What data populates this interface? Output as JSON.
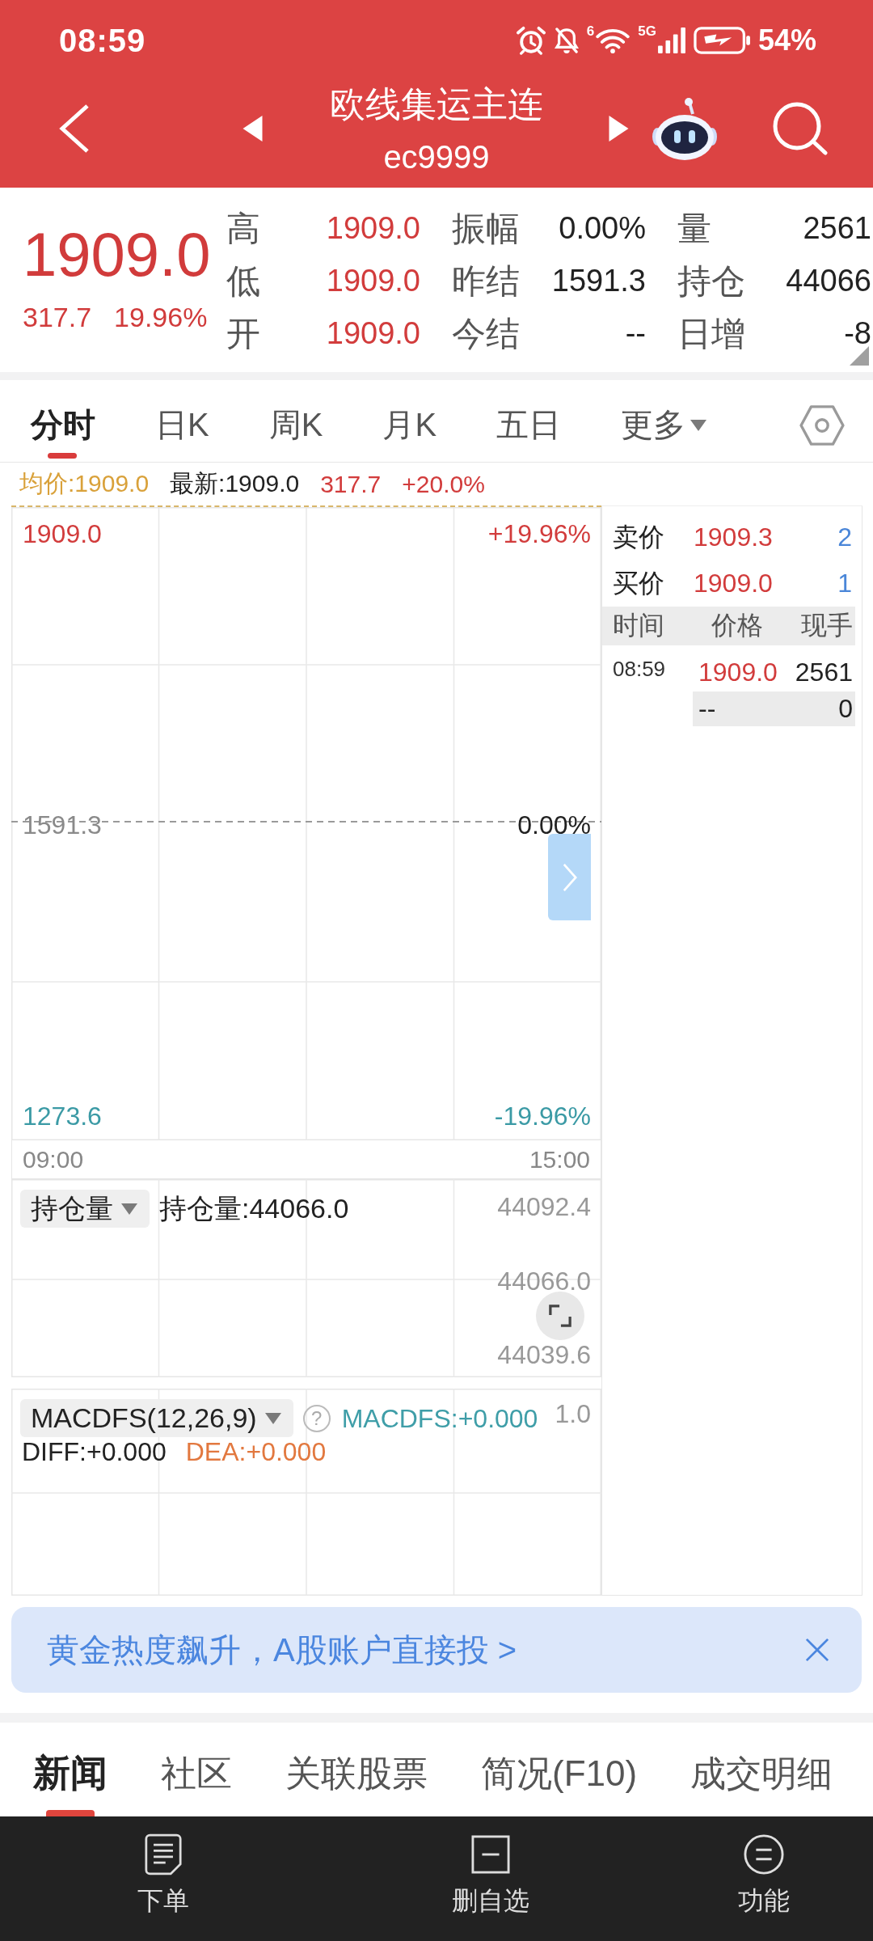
{
  "status_bar": {
    "time": "08:59",
    "wifi_label": "6",
    "signal_label": "5G",
    "battery": "54%"
  },
  "header": {
    "title": "欧线集运主连",
    "code": "ec9999"
  },
  "quote": {
    "price": "1909.0",
    "change": "317.7",
    "change_pct": "19.96%",
    "fields": [
      {
        "label": "高",
        "value": "1909.0",
        "kind": "up"
      },
      {
        "label": "振幅",
        "value": "0.00%",
        "kind": "flat"
      },
      {
        "label": "量",
        "value": "2561",
        "kind": "flat"
      },
      {
        "label": "低",
        "value": "1909.0",
        "kind": "up"
      },
      {
        "label": "昨结",
        "value": "1591.3",
        "kind": "flat"
      },
      {
        "label": "持仓",
        "value": "44066",
        "kind": "flat"
      },
      {
        "label": "开",
        "value": "1909.0",
        "kind": "up"
      },
      {
        "label": "今结",
        "value": "--",
        "kind": "flat"
      },
      {
        "label": "日增",
        "value": "-8",
        "kind": "flat"
      }
    ]
  },
  "chart_tabs": [
    {
      "label": "分时",
      "selected": true,
      "kind": "tab"
    },
    {
      "label": "日K",
      "selected": false,
      "kind": "tab"
    },
    {
      "label": "周K",
      "selected": false,
      "kind": "tab"
    },
    {
      "label": "月K",
      "selected": false,
      "kind": "tab"
    },
    {
      "label": "五日",
      "selected": false,
      "kind": "tab"
    },
    {
      "label": "更多",
      "selected": false,
      "kind": "menu"
    }
  ],
  "legend": [
    {
      "text": "均价:1909.0",
      "kind": "avg"
    },
    {
      "text": "最新:1909.0",
      "kind": "flat"
    },
    {
      "text": "317.7",
      "kind": "up"
    },
    {
      "text": "+20.0%",
      "kind": "up"
    }
  ],
  "price_chart": {
    "left_labels": [
      {
        "text": "1909.0",
        "kind": "up"
      },
      {
        "text": "1591.3",
        "kind": "base"
      },
      {
        "text": "1273.6",
        "kind": "down"
      }
    ],
    "right_labels": [
      {
        "text": "+19.96%",
        "kind": "up"
      },
      {
        "text": "0.00%",
        "kind": "flat"
      },
      {
        "text": "-19.96%",
        "kind": "down"
      }
    ],
    "time_labels": [
      "09:00",
      "15:00"
    ]
  },
  "holdings_chart": {
    "indicator": "持仓量",
    "readout": "持仓量:44066.0",
    "axis_labels": [
      "44092.4",
      "44066.0",
      "44039.6"
    ]
  },
  "macd_chart": {
    "indicator": "MACDFS(12,26,9)",
    "help": "?",
    "axis_label": "1.0",
    "readouts": [
      {
        "text": "MACDFS:+0.000",
        "kind": "macd"
      },
      {
        "text": "DIFF:+0.000",
        "kind": "flat"
      },
      {
        "text": "DEA:+0.000",
        "kind": "dea"
      }
    ]
  },
  "order_book": {
    "quotes": [
      {
        "label": "卖价",
        "price": "1909.3",
        "volume": "2"
      },
      {
        "label": "买价",
        "price": "1909.0",
        "volume": "1"
      }
    ],
    "columns": [
      "时间",
      "价格",
      "现手"
    ],
    "trades": [
      {
        "time": "08:59",
        "price": "1909.0",
        "volume": "2561",
        "kind": "up",
        "highlighted": false
      },
      {
        "price": "--",
        "volume": "0",
        "kind": "flat",
        "highlighted": true
      }
    ]
  },
  "banner": {
    "text": "黄金热度飙升，A股账户直接投 >"
  },
  "info_tabs": [
    {
      "label": "新闻",
      "selected": true
    },
    {
      "label": "社区",
      "selected": false
    },
    {
      "label": "关联股票",
      "selected": false
    },
    {
      "label": "简况(F10)",
      "selected": false
    },
    {
      "label": "成交明细",
      "selected": false
    }
  ],
  "bottom_nav": [
    {
      "label": "下单"
    },
    {
      "label": "删自选"
    },
    {
      "label": "功能"
    }
  ]
}
